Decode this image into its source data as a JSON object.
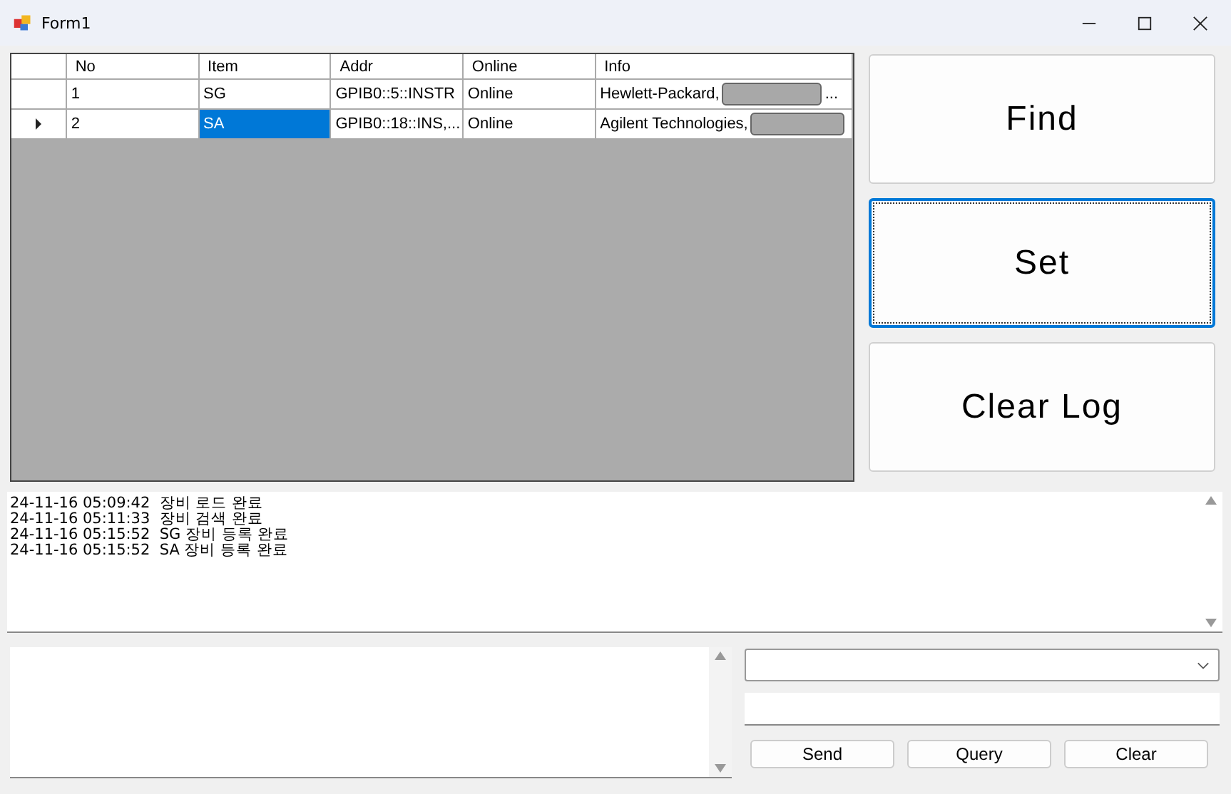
{
  "window": {
    "title": "Form1"
  },
  "grid": {
    "columns": [
      "No",
      "Item",
      "Addr",
      "Online",
      "Info"
    ],
    "rows": [
      {
        "selected": false,
        "cells": [
          {
            "text": "1",
            "selected": false
          },
          {
            "text": "SG",
            "selected": false
          },
          {
            "text": "GPIB0::5::INSTR",
            "selected": false
          },
          {
            "text": "Online",
            "selected": false
          },
          {
            "text": "Hewlett-Packard,",
            "selected": false,
            "redacted": true,
            "tail": "..."
          }
        ]
      },
      {
        "selected": true,
        "cells": [
          {
            "text": "2",
            "selected": false
          },
          {
            "text": "SA",
            "selected": true
          },
          {
            "text": "GPIB0::18::INS,...",
            "selected": false
          },
          {
            "text": "Online",
            "selected": false
          },
          {
            "text": "Agilent Technologies,",
            "selected": false,
            "redacted": true
          }
        ]
      }
    ]
  },
  "actions": [
    {
      "label": "Find",
      "focused": false
    },
    {
      "label": "Set",
      "focused": true
    },
    {
      "label": "Clear Log",
      "focused": false
    }
  ],
  "log": [
    "24-11-16 05:09:42  장비 로드 완료",
    "24-11-16 05:11:33  장비 검색 완료",
    "24-11-16 05:15:52  SG 장비 등록 완료",
    "24-11-16 05:15:52  SA 장비 등록 완료"
  ],
  "command_buttons": [
    "Send",
    "Query",
    "Clear"
  ]
}
